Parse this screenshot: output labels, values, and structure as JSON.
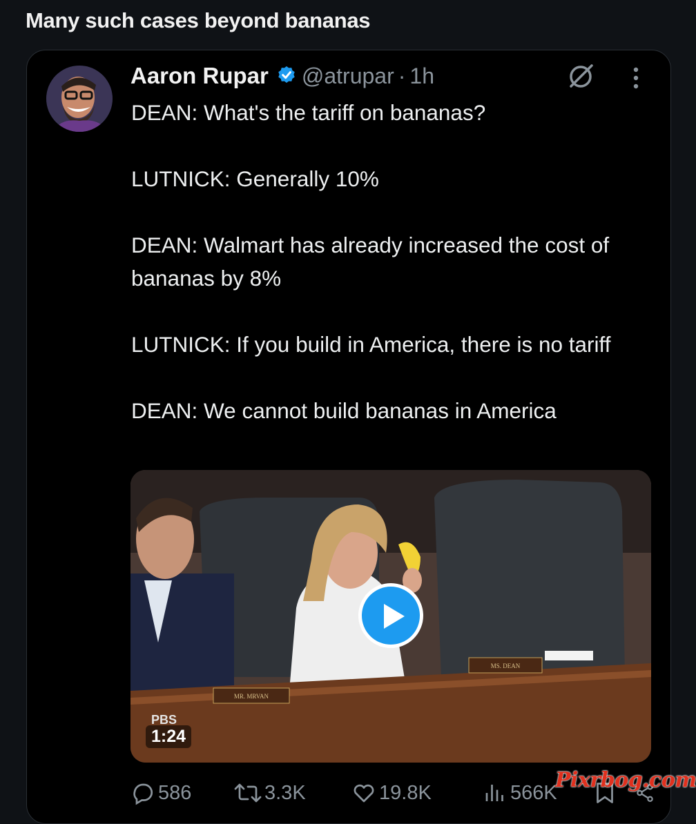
{
  "post": {
    "title": "Many such cases beyond bananas"
  },
  "tweet": {
    "author_name": "Aaron Rupar",
    "handle": "@atrupar",
    "separator": "·",
    "time": "1h",
    "verified": true,
    "lines": [
      "DEAN: What's the tariff on bananas?",
      "LUTNICK: Generally 10%",
      "DEAN: Walmart has already increased the cost of bananas by 8%",
      "LUTNICK: If you build in America, there is no tariff",
      "DEAN: We cannot build bananas in America"
    ],
    "media": {
      "duration": "1:24",
      "broadcaster_logo": "PBS",
      "nameplate_left": "MR. MRVAN",
      "nameplate_right": "MS. DEAN"
    },
    "actions": {
      "replies": "586",
      "reposts": "3.3K",
      "likes": "19.8K",
      "views": "566K"
    }
  },
  "watermark": "Pixrbog.com",
  "colors": {
    "accent": "#1d9bf0",
    "muted": "#8b949c",
    "background": "#000000"
  },
  "icons": [
    "verified-icon",
    "grok-icon",
    "more-icon",
    "play-icon",
    "reply-icon",
    "repost-icon",
    "like-icon",
    "views-icon",
    "bookmark-icon",
    "share-icon"
  ]
}
